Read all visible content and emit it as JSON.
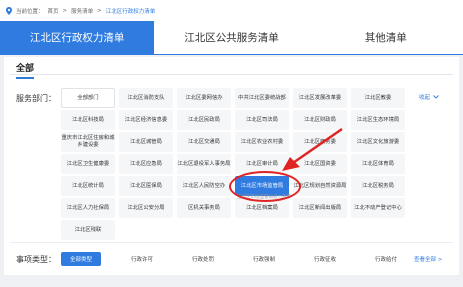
{
  "breadcrumb": {
    "prefix": "当前位置：",
    "home": "首页",
    "level2": "服务清单",
    "current": "江北区行政权力清单",
    "sep": ">"
  },
  "tabs": [
    "江北区行政权力清单",
    "江北区公共服务清单",
    "其他清单"
  ],
  "subtab": "全部",
  "dept_label": "服务部门：",
  "collapse_label": "收起",
  "departments": [
    "全部部门",
    "江北区消防支队",
    "江北区委网信办",
    "中共江北区委统战部",
    "江北区发展改革委",
    "江北区教委",
    "江北区科技局",
    "江北区经济信息委",
    "江北区民政局",
    "江北区司法局",
    "江北区财政局",
    "江北区生态环境局",
    "重庆市江北区住房和城乡建设委",
    "江北区城管局",
    "江北区交通局",
    "江北区农业农村委",
    "江北区商务委",
    "江北区文化旅游委",
    "江北区卫生健康委",
    "江北区应急局",
    "江北区退役军人事务局",
    "江北区审计局",
    "江北区国资委",
    "江北区体育局",
    "江北区统计局",
    "江北区医保局",
    "江北区人民防空办",
    "江北区市场监管局",
    "江北区规划自然资源局",
    "江北区税务局",
    "江北区人力社保局",
    "江北区公安分局",
    "区机关事务局",
    "江北区档案局",
    "江北区新闻出版局",
    "江北不动产登记中心",
    "江北区残联"
  ],
  "hover_tooltip": "江北区市场监管局权力清单",
  "type_label": "事项类型：",
  "types": [
    "全部类型",
    "行政许可",
    "行政处罚",
    "行政强制",
    "行政征收",
    "行政给付"
  ],
  "view_all": "查看全部 >",
  "accent_color": "#2f7be0",
  "annotation_color": "#e02424"
}
